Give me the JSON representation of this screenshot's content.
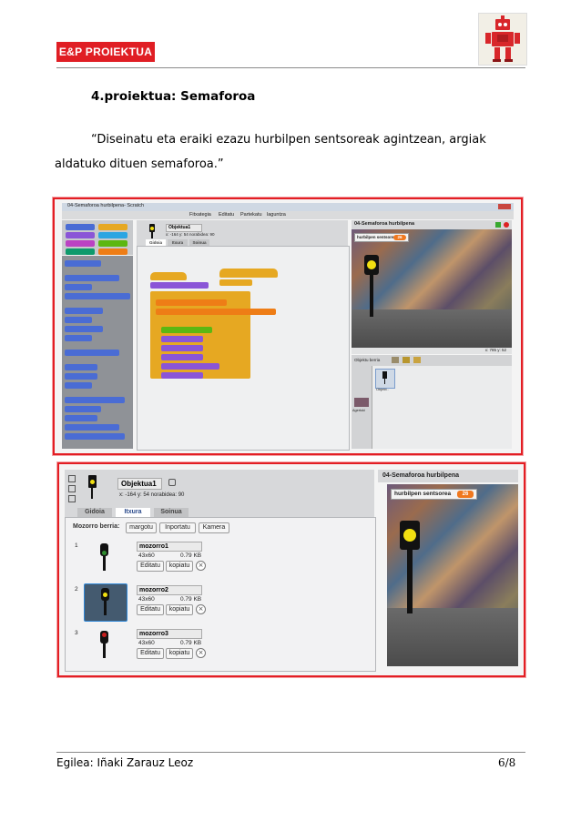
{
  "header": {
    "logo_text": "E&P PROIEKTUA"
  },
  "document": {
    "title": "4.proiektua: Semaforoa",
    "paragraph_line1": "“Diseinatu eta eraiki ezazu hurbilpen sentsoreak agintzean, argiak",
    "paragraph_line2": "aldatuko dituen semaforoa.”"
  },
  "screenshot1": {
    "window_title": "04-Semaforoa hurbilpena- Scratch",
    "menu": [
      "Fitxategia",
      "Editatu",
      "Partekatu",
      "laguntza"
    ],
    "sprite_name": "Objektua1",
    "coords": "x: -164 y: 54   norabidea: 90",
    "tabs": [
      "Gidoia",
      "Itxura",
      "Soinua"
    ],
    "categories": [
      "Mugimendua",
      "Kontrola",
      "Itxura",
      "Sentsoreak",
      "Soinua",
      "Eragileak",
      "Arkatza",
      "Aldagaiak"
    ],
    "palette_blocks": [
      "mugitu 10 urrats",
      "biratu 15 gradu",
      "biratu 15 gradu",
      "zuzendu 90 norabidea",
      "joan x: -164 y: 54",
      "joan 🖱",
      "irristatu 1 segundotan x: -164 y: 54",
      "aldatu x 10 aldiz",
      "ezarri x 0",
      "aldatu y 10 aldiz",
      "ezarri y 0",
      "ertzean ukituz bueltatu",
      "x posizioa",
      "y posizioa",
      "norabidea",
      "mozorroa pitzturi 2 segundutan",
      "mozorroa pitzturi",
      "mozorroa itzultzi",
      "mozorroaren ukabonoa 100",
      "mozorroa norabidea honela"
    ],
    "script_blocks": [
      "sakatzean",
      "aldatu mozorroa mozorro1",
      "beti",
      "ezarri hurbilpen sentsorea balioa",
      "ezarri hurbilpen sentsorea sentsorearen balioa distantzia",
      "baldin eta hurbilpen sentsorea < 20",
      "aldatu mozorroa",
      "bestela",
      "aldatu mozorroa",
      "bestela",
      "aldatu mozorroa",
      "itxaron 1 segundo"
    ],
    "stage_title": "04-Semaforoa hurbilpena",
    "sensor_label": "hurbilpen sentsorea",
    "sensor_value": "26",
    "stage_coords": "x: 785  y: 52",
    "sprite_list_label": "Objektu berria",
    "sprite_thumb_label": "Objekt..",
    "stage_thumb_label": "Agertoki"
  },
  "screenshot2": {
    "sprite_name": "Objektua1",
    "coords": "x: -164  y: 54     norabidea: 90",
    "tabs": [
      "Gidoia",
      "Itxura",
      "Soinua"
    ],
    "new_costume_label": "Mozorro berria:",
    "new_costume_buttons": [
      "margotu",
      "Inportatu",
      "Kamera"
    ],
    "costumes": [
      {
        "index": "1",
        "name": "mozorro1",
        "dims": "43x60",
        "size": "0.79 KB",
        "edit": "Editatu",
        "copy": "kopiatu",
        "light": "#2e8b2e"
      },
      {
        "index": "2",
        "name": "mozorro2",
        "dims": "43x60",
        "size": "0.79 KB",
        "edit": "Editatu",
        "copy": "kopiatu",
        "light": "#f2e011"
      },
      {
        "index": "3",
        "name": "mozorro3",
        "dims": "43x60",
        "size": "0.79 KB",
        "edit": "Editatu",
        "copy": "kopiatu",
        "light": "#c81e1e"
      }
    ],
    "stage_title": "04-Semaforoa hurbilpena",
    "sensor_label": "hurbilpen sentsorea",
    "sensor_value": "26"
  },
  "footer": {
    "author": "Egilea: Iñaki Zarauz Leoz",
    "page": "6/8"
  },
  "colors": {
    "logo_red": "#e01e24",
    "frame_red": "#e31e24",
    "sensor_orange": "#f0781e",
    "light_yellow": "#f2e011",
    "block_blue": "#4a6cd4",
    "block_orange": "#e6a822",
    "block_purple": "#8a55d7",
    "block_green": "#5cb712"
  }
}
